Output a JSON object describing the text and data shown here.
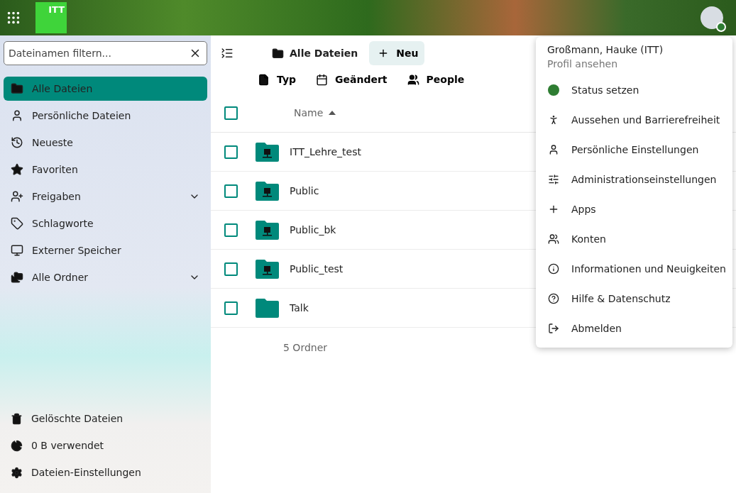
{
  "header": {
    "logo_text": "ITT",
    "user_online": true
  },
  "sidebar": {
    "filter": {
      "placeholder": "Dateinamen filtern..."
    },
    "items": [
      {
        "label": "Alle Dateien",
        "selected": true
      },
      {
        "label": "Persönliche Dateien",
        "selected": false
      },
      {
        "label": "Neueste",
        "selected": false
      },
      {
        "label": "Favoriten",
        "selected": false
      },
      {
        "label": "Freigaben",
        "selected": false,
        "expanded": false
      },
      {
        "label": "Schlagworte",
        "selected": false
      },
      {
        "label": "Externer Speicher",
        "selected": false
      },
      {
        "label": "Alle Ordner",
        "selected": false,
        "expanded": false
      }
    ],
    "footer": [
      "Gelöschte Dateien",
      "0 B verwendet",
      "Dateien-Einstellungen"
    ]
  },
  "breadcrumb": "Alle Dateien",
  "new_button": "Neu",
  "filters": [
    "Typ",
    "Geändert",
    "People"
  ],
  "table": {
    "all_checked": false,
    "columns": [
      {
        "label": "Name",
        "sorted_ascending": true
      }
    ],
    "rows": [
      {
        "name": "ITT_Lehre_test",
        "kind": "external",
        "checked": false
      },
      {
        "name": "Public",
        "kind": "external",
        "checked": false
      },
      {
        "name": "Public_bk",
        "kind": "external",
        "checked": false
      },
      {
        "name": "Public_test",
        "kind": "external",
        "checked": false
      },
      {
        "name": "Talk",
        "kind": "folder",
        "checked": false
      }
    ],
    "summary": "5 Ordner"
  },
  "user_menu": {
    "name": "Großmann, Hauke (ITT)",
    "profile_link": "Profil ansehen",
    "items": [
      {
        "label": "Status setzen",
        "kind": "status",
        "color": "#2e7d32"
      },
      {
        "label": "Aussehen und Barrierefreiheit",
        "kind": "icon"
      },
      {
        "label": "Persönliche Einstellungen",
        "kind": "icon"
      },
      {
        "label": "Administrationseinstellungen",
        "kind": "icon"
      },
      {
        "label": "Apps",
        "kind": "icon"
      },
      {
        "label": "Konten",
        "kind": "icon"
      },
      {
        "label": "Informationen und Neuigkeiten",
        "kind": "icon"
      },
      {
        "label": "Hilfe & Datenschutz",
        "kind": "icon"
      },
      {
        "label": "Abmelden",
        "kind": "icon"
      }
    ]
  }
}
